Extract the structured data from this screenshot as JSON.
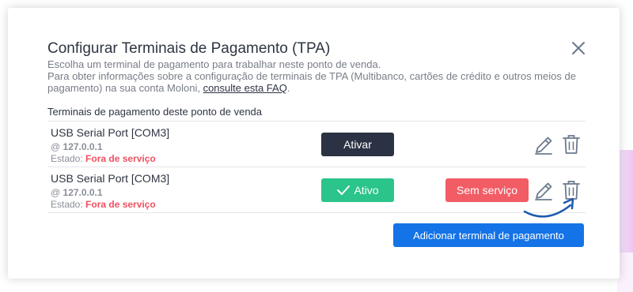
{
  "modal": {
    "title": "Configurar Terminais de Pagamento (TPA)",
    "description_line1": "Escolha um terminal de pagamento para trabalhar neste ponto de venda.",
    "description_line2": "Para obter informações sobre a configuração de terminais de TPA (Multibanco, cartões de crédito e outros meios de pagamento) na sua conta Moloni, ",
    "faq_link": "consulte esta FAQ",
    "description_end": ".",
    "section_label": "Terminais de pagamento deste ponto de venda",
    "close_icon": "close-icon"
  },
  "terminals": [
    {
      "name": "USB Serial Port [COM3]",
      "ip_prefix": "@ ",
      "ip": "127.0.0.1",
      "status_label": "Estado: ",
      "status_value": "Fora de serviço",
      "activate_label": "Ativar"
    },
    {
      "name": "USB Serial Port [COM3]",
      "ip_prefix": "@ ",
      "ip": "127.0.0.1",
      "status_label": "Estado: ",
      "status_value": "Fora de serviço",
      "active_label": "Ativo",
      "out_of_service_label": "Sem serviço"
    }
  ],
  "add_button_label": "Adicionar terminal de pagamento",
  "colors": {
    "dark_button": "#2b3243",
    "active_green": "#2bc48a",
    "out_of_service_red": "#f25c65",
    "primary_blue": "#1473e6",
    "status_red": "#f0505f"
  }
}
